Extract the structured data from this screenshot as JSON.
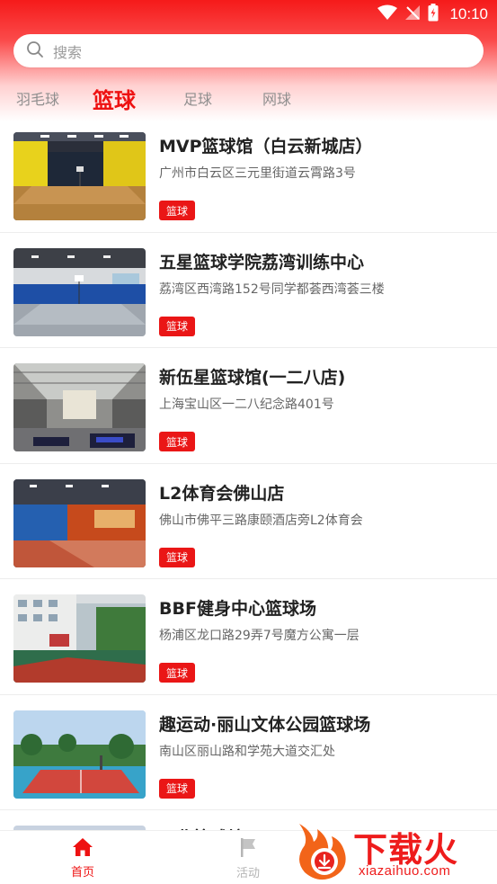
{
  "status_bar": {
    "time": "10:10"
  },
  "search": {
    "placeholder": "搜索"
  },
  "tabs": [
    {
      "label": "羽毛球",
      "active": false
    },
    {
      "label": "篮球",
      "active": true
    },
    {
      "label": "足球",
      "active": false
    },
    {
      "label": "网球",
      "active": false
    }
  ],
  "venues": [
    {
      "title": "MVP篮球馆（白云新城店）",
      "address": "广州市白云区三元里街道云霄路3号",
      "tag": "篮球"
    },
    {
      "title": "五星篮球学院荔湾训练中心",
      "address": "荔湾区西湾路152号同学都荟西湾荟三楼",
      "tag": "篮球"
    },
    {
      "title": "新伍星篮球馆(一二八店)",
      "address": "上海宝山区一二八纪念路401号",
      "tag": "篮球"
    },
    {
      "title": "L2体育会佛山店",
      "address": "佛山市佛平三路康颐酒店旁L2体育会",
      "tag": "篮球"
    },
    {
      "title": "BBF健身中心篮球场",
      "address": "杨浦区龙口路29弄7号魔方公寓一层",
      "tag": "篮球"
    },
    {
      "title": "趣运动·丽山文体公园篮球场",
      "address": "南山区丽山路和学苑大道交汇处",
      "tag": "篮球"
    }
  ],
  "partial_item": {
    "title": "正北篮球坊"
  },
  "bottom_nav": [
    {
      "label": "首页",
      "icon": "home-icon",
      "active": true
    },
    {
      "label": "活动",
      "icon": "flag-icon",
      "active": false
    }
  ],
  "watermark": {
    "text": "下载火",
    "url": "xiazaihuo.com"
  },
  "colors": {
    "accent": "#ee1111",
    "tag_bg": "#ea1616",
    "header_top": "#f51a1a"
  }
}
